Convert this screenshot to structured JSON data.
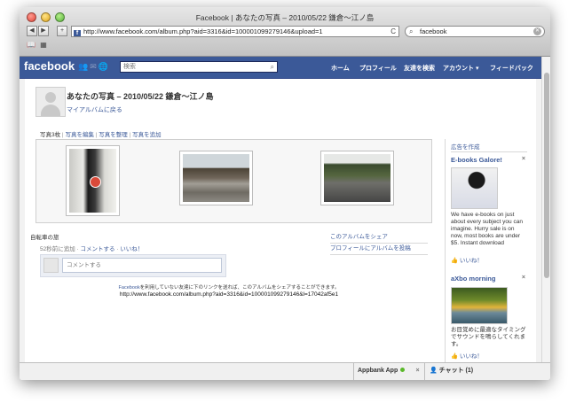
{
  "browser": {
    "title": "Facebook | あなたの写真 – 2010/05/22 鎌倉〜江ノ島",
    "url": "http://www.facebook.com/album.php?aid=3316&id=100001099279146&upload=1",
    "search_value": "facebook",
    "back_label": "◀",
    "forward_label": "▶",
    "add_label": "+",
    "reload_label": "C"
  },
  "fb": {
    "logo": "facebook",
    "search_placeholder": "検索",
    "nav": [
      "ホーム",
      "プロフィール",
      "友達を検索",
      "アカウント ▾",
      "フィードバック"
    ]
  },
  "album": {
    "title": "あなたの写真 – 2010/05/22 鎌倉〜江ノ島",
    "back_link": "マイアルバムに戻る",
    "count": "写真3枚",
    "actions": [
      "写真を編集",
      "写真を整理",
      "写真を追加"
    ],
    "name": "自転車の旅",
    "added_time": "52秒前に追加 · ",
    "comment_link": "コメントする",
    "like_link": "いいね！",
    "share_links": [
      "このアルバムをシェア",
      "プロフィールにアルバムを投稿"
    ],
    "comment_placeholder": "コメントする",
    "share_note_link": "Facebook",
    "share_note_text": "を利用していない友達に下のリンクを送れば、このアルバムをシェアすることができます。",
    "share_url": "http://www.facebook.com/album.php?aid=3316&id=100001099279146&l=17042af5e1"
  },
  "ads": {
    "create_link": "広告を作成",
    "items": [
      {
        "title": "E-books Galore!",
        "text": "We have e-books on just about every subject you can imagine. Hurry sale is on now, most books are under $5. Instant download",
        "like": "いいね！"
      },
      {
        "title": "aXbo morning",
        "text": "お目覚めに最適なタイミングでサウンドを鳴らしてくれます。",
        "like": "いいね！"
      }
    ]
  },
  "chat": {
    "app_label": "Appbank App",
    "chat_label": "チャット (1)",
    "close_label": "×"
  },
  "colors": {
    "facebook_blue": "#3b5998",
    "link": "#3b5998",
    "online_dot": "#5ab82a"
  }
}
